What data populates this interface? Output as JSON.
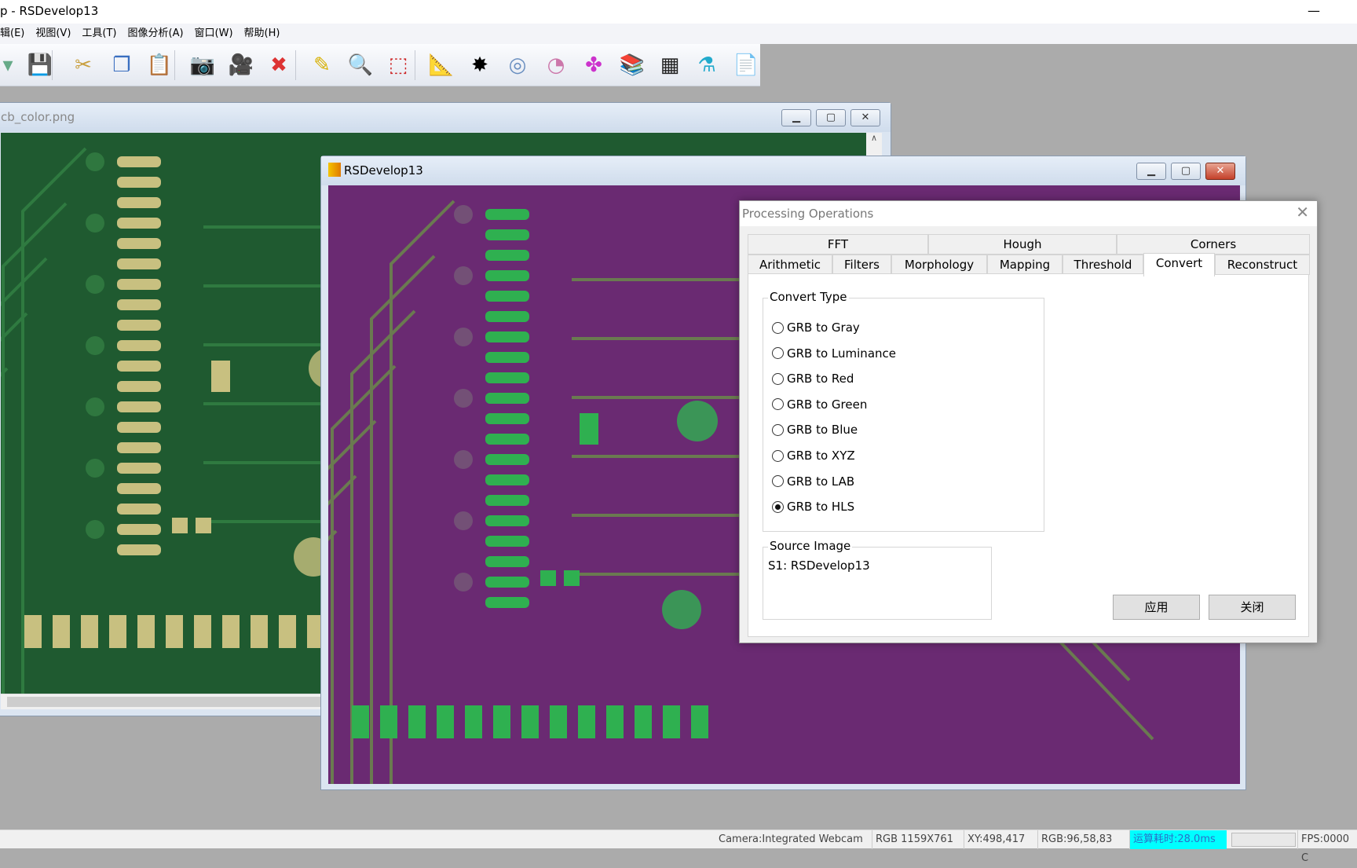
{
  "app": {
    "title": "p - RSDevelop13"
  },
  "menu": [
    "辑(E)",
    "视图(V)",
    "工具(T)",
    "图像分析(A)",
    "窗口(W)",
    "帮助(H)"
  ],
  "toolbar": [
    {
      "icon": "open-icon",
      "glyph": "▾",
      "color": "#6a8"
    },
    {
      "icon": "save-icon",
      "glyph": "💾",
      "color": "#3a3"
    },
    {
      "icon": "cut-icon",
      "glyph": "✂",
      "color": "#c9a040"
    },
    {
      "icon": "copy-icon",
      "glyph": "❐",
      "color": "#3a6fc0"
    },
    {
      "icon": "paste-icon",
      "glyph": "📋",
      "color": "#d08a20"
    },
    {
      "icon": "camera-icon",
      "glyph": "📷",
      "color": "#999"
    },
    {
      "icon": "video-camera-icon",
      "glyph": "🎥",
      "color": "#333"
    },
    {
      "icon": "delete-icon",
      "glyph": "✖",
      "color": "#d33"
    },
    {
      "icon": "edit-image-icon",
      "glyph": "✎",
      "color": "#d7b000"
    },
    {
      "icon": "zoom-icon",
      "glyph": "🔍",
      "color": "#2a7fd8"
    },
    {
      "icon": "crop-icon",
      "glyph": "⬚",
      "color": "#c22"
    },
    {
      "icon": "ruler-icon",
      "glyph": "📐",
      "color": "#c9a040"
    },
    {
      "icon": "blob-icon",
      "glyph": "✸",
      "color": "#000"
    },
    {
      "icon": "target-icon",
      "glyph": "◎",
      "color": "#6a8fc0"
    },
    {
      "icon": "pig-icon",
      "glyph": "◔",
      "color": "#c7a"
    },
    {
      "icon": "puzzle-icon",
      "glyph": "✤",
      "color": "#c3c"
    },
    {
      "icon": "books-icon",
      "glyph": "📚",
      "color": "#d64"
    },
    {
      "icon": "qr-code-icon",
      "glyph": "▦",
      "color": "#222"
    },
    {
      "icon": "flask-icon",
      "glyph": "⚗",
      "color": "#2ac"
    },
    {
      "icon": "document-icon",
      "glyph": "📄",
      "color": "#8a6"
    }
  ],
  "window1": {
    "title": "cb_color.png"
  },
  "window2": {
    "title": "RSDevelop13"
  },
  "dialog": {
    "title": "Processing Operations",
    "tabs_row1": [
      "FFT",
      "Hough",
      "Corners"
    ],
    "tabs_row2": [
      "Arithmetic",
      "Filters",
      "Morphology",
      "Mapping",
      "Threshold",
      "Convert",
      "Reconstruct"
    ],
    "active_tab": "Convert",
    "convert_type": {
      "label": "Convert Type",
      "options": [
        "GRB to Gray",
        "GRB to Luminance",
        "GRB to Red",
        "GRB to Green",
        "GRB to Blue",
        "GRB to XYZ",
        "GRB to LAB",
        "GRB to HLS"
      ],
      "selected": "GRB to HLS"
    },
    "source_image": {
      "label": "Source Image",
      "value": "S1: RSDevelop13"
    },
    "apply_label": "应用",
    "close_label": "关闭"
  },
  "status": {
    "camera": "Camera:Integrated Webcam",
    "size": "RGB 1159X761",
    "xy": "XY:498,417",
    "rgb": "RGB:96,58,83",
    "time": "运算耗时:28.0ms",
    "fps": "FPS:0000 C",
    "highlight_color": "#00ffff"
  },
  "colors": {
    "pcb_green": "#1f5a30",
    "pcb_purple": "#6a2a72",
    "pad_gold": "#c8c080",
    "pad_green": "#2fb050"
  }
}
